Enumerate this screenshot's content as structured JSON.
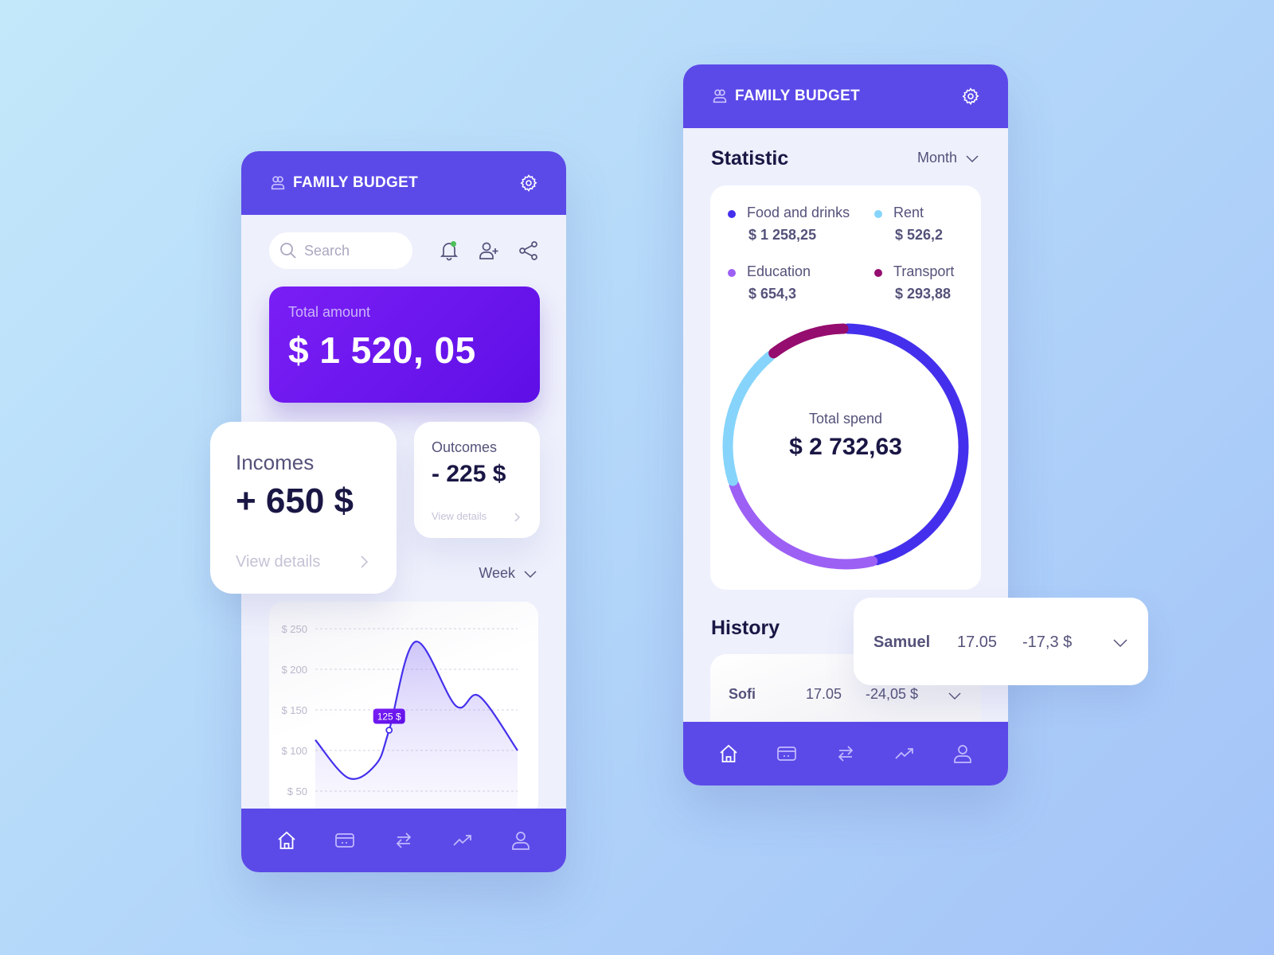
{
  "app": {
    "title": "FAMILY BUDGET"
  },
  "colors": {
    "primary": "#5b4ae8",
    "total_card": "#6a16f0",
    "food": "#4430ec",
    "rent": "#86d4fb",
    "education": "#9d60f5",
    "transport": "#950d6e",
    "notification_dot": "#4cc058"
  },
  "home": {
    "search": {
      "placeholder": "Search",
      "value": ""
    },
    "total": {
      "label": "Total amount",
      "value": "$ 1 520, 05"
    },
    "incomes": {
      "label": "Incomes",
      "value": "+ 650 $",
      "details": "View details"
    },
    "outcomes": {
      "label": "Outcomes",
      "value": "- 225 $",
      "details": "View details"
    },
    "period": {
      "selected": "Week"
    },
    "icons": [
      "bell-icon",
      "add-user-icon",
      "share-icon"
    ]
  },
  "chart_data": {
    "type": "area",
    "title": "",
    "xlabel": "",
    "ylabel": "",
    "ylim": [
      50,
      250
    ],
    "yticks": [
      250,
      200,
      150,
      100,
      50
    ],
    "ytick_labels": [
      "$ 250",
      "$ 200",
      "$ 150",
      "$ 100",
      "$ 50"
    ],
    "grid": true,
    "x": [
      0,
      1,
      2,
      3,
      4,
      5,
      6,
      7
    ],
    "values": [
      113,
      66,
      83,
      125,
      234,
      155,
      167,
      100
    ],
    "highlight": {
      "index": 3,
      "label": "125 $"
    }
  },
  "stats": {
    "title": "Statistic",
    "period": {
      "selected": "Month"
    },
    "categories": [
      {
        "name": "Food and drinks",
        "amount": "$ 1 258,25",
        "value": 1258.25,
        "color": "#4430ec"
      },
      {
        "name": "Rent",
        "amount": "$ 526,2",
        "value": 526.2,
        "color": "#86d4fb"
      },
      {
        "name": "Education",
        "amount": "$ 654,3",
        "value": 654.3,
        "color": "#9d60f5"
      },
      {
        "name": "Transport",
        "amount": "$ 293,88",
        "value": 293.88,
        "color": "#950d6e"
      }
    ],
    "donut_order": [
      0,
      2,
      1,
      3
    ],
    "total_label": "Total spend",
    "total_value": "$ 2 732,63"
  },
  "history": {
    "title": "History",
    "rows": [
      {
        "name": "Samuel",
        "date": "17.05",
        "amount": "-17,3 $"
      },
      {
        "name": "Sofi",
        "date": "17.05",
        "amount": "-24,05 $"
      }
    ]
  },
  "nav": {
    "items": [
      {
        "name": "home",
        "active": true
      },
      {
        "name": "cards",
        "active": false
      },
      {
        "name": "transfers",
        "active": false
      },
      {
        "name": "analytics",
        "active": false
      },
      {
        "name": "profile",
        "active": false
      }
    ]
  }
}
